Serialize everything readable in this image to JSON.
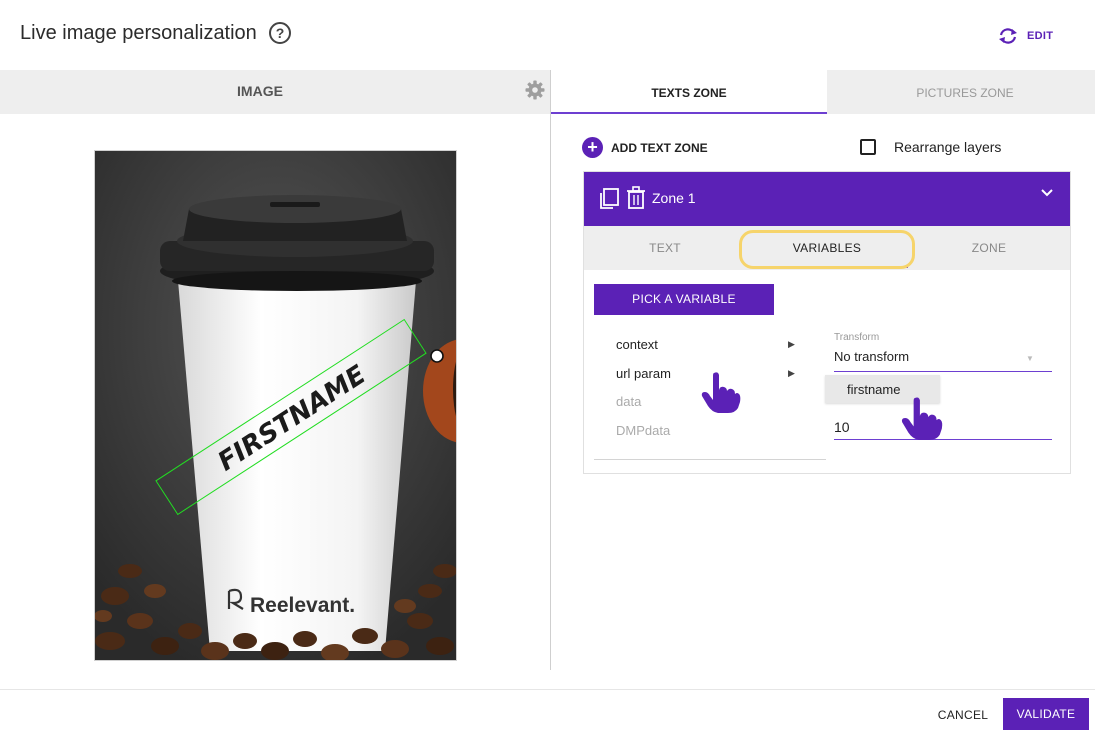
{
  "header": {
    "title": "Live image personalization",
    "help_glyph": "?",
    "edit_label": "EDIT"
  },
  "left_panel": {
    "title": "IMAGE",
    "canvas": {
      "text_zone_label": "FIRSTNAME",
      "brand_text": "Reelevant."
    }
  },
  "right_panel": {
    "tabs": [
      {
        "label": "TEXTS ZONE",
        "active": true
      },
      {
        "label": "PICTURES ZONE",
        "active": false
      }
    ],
    "add_text_zone_label": "ADD TEXT ZONE",
    "add_glyph": "+",
    "rearrange_label": "Rearrange layers",
    "zone": {
      "title": "Zone 1",
      "sub_tabs": [
        {
          "label": "TEXT",
          "active": false
        },
        {
          "label": "VARIABLES",
          "active": true
        },
        {
          "label": "ZONE",
          "active": false
        }
      ],
      "pick_variable_label": "PICK A VARIABLE",
      "menu_items": [
        {
          "label": "context",
          "enabled": true,
          "has_submenu": true
        },
        {
          "label": "url param",
          "enabled": true,
          "has_submenu": true
        },
        {
          "label": "data",
          "enabled": false,
          "has_submenu": false
        },
        {
          "label": "DMPdata",
          "enabled": false,
          "has_submenu": false
        }
      ],
      "submenu_item": "firstname",
      "transform_label": "Transform",
      "transform_value": "No transform",
      "number_value": "10"
    }
  },
  "footer": {
    "cancel_label": "CANCEL",
    "validate_label": "VALIDATE"
  },
  "colors": {
    "accent": "#5b21b6",
    "highlight": "#f6d46b",
    "zone_box": "#22dd22"
  },
  "icons": [
    "help-icon",
    "sync-icon",
    "gear-icon",
    "copy-icon",
    "trash-icon",
    "chevron-down-icon",
    "caret-right-icon",
    "hand-pointer-icon"
  ]
}
